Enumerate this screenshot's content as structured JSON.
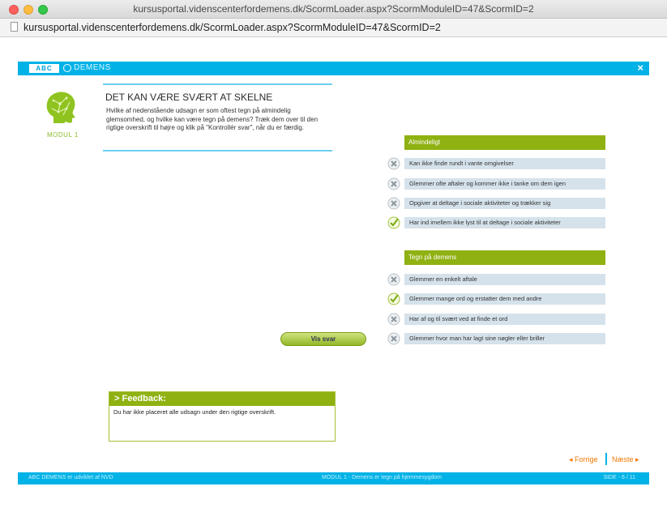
{
  "window": {
    "title": "kursusportal.videnscenterfordemens.dk/ScormLoader.aspx?ScormModuleID=47&ScormID=2",
    "url": "kursusportal.videnscenterfordemens.dk/ScormLoader.aspx?ScormModuleID=47&ScormID=2"
  },
  "header": {
    "logo": "ABC",
    "brand": "DEMENS",
    "close": "×"
  },
  "module": {
    "label": "MODUL 1"
  },
  "intro": {
    "title": "DET KAN VÆRE SVÆRT AT SKELNE",
    "text": "Hvilke af nedenstående udsagn er som oftest tegn på almindelig glemsomhed, og hvilke kan være tegn på demens? Træk dem over til den rigtige overskrift til højre og klik på \"Kontrollér svar\", når du er færdig."
  },
  "categories": [
    {
      "title": "Almindeligt",
      "items": [
        {
          "text": "Kan ikke finde rundt i vante omgivelser",
          "status": "wrong"
        },
        {
          "text": "Glemmer ofte aftaler og kommer ikke i tanke om dem igen",
          "status": "wrong"
        },
        {
          "text": "Opgiver at deltage i sociale aktiviteter og trækker sig",
          "status": "wrong"
        },
        {
          "text": "Har ind imellem ikke lyst til at deltage i sociale aktiviteter",
          "status": "correct"
        }
      ]
    },
    {
      "title": "Tegn på demens",
      "items": [
        {
          "text": "Glemmer en enkelt aftale",
          "status": "wrong"
        },
        {
          "text": "Glemmer mange ord og erstatter dem med andre",
          "status": "correct"
        },
        {
          "text": "Har af og til svært ved at finde et ord",
          "status": "wrong"
        },
        {
          "text": "Glemmer hvor man har lagt sine nøgler eller briller",
          "status": "wrong"
        }
      ]
    }
  ],
  "buttons": {
    "show_answer": "Vis svar"
  },
  "feedback": {
    "heading": "> Feedback:",
    "text": "Du har ikke placeret alle udsagn under den rigtige overskrift."
  },
  "navigation": {
    "prev": "◂ Forrige",
    "next": "Næste ▸"
  },
  "footer": {
    "left": "ABC DEMENS er udviklet af NVD",
    "middle": "MODUL 1 - Demens er tegn på hjemmesygdom",
    "right": "SIDE - 6 / 11"
  },
  "colors": {
    "accent": "#00b2e6",
    "green": "#8fb112",
    "orange": "#f07800"
  }
}
